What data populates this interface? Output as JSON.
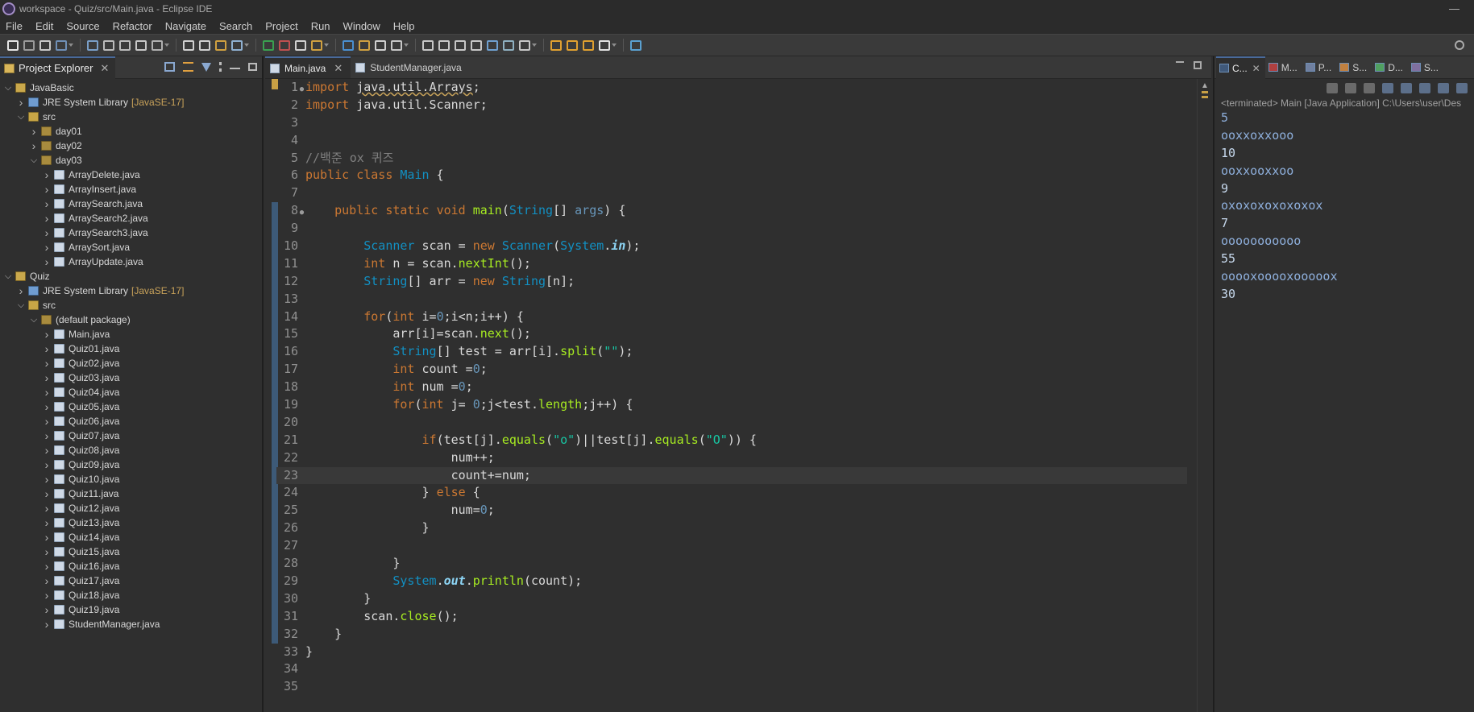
{
  "window": {
    "title": "workspace - Quiz/src/Main.java - Eclipse IDE"
  },
  "menu": [
    "File",
    "Edit",
    "Source",
    "Refactor",
    "Navigate",
    "Search",
    "Project",
    "Run",
    "Window",
    "Help"
  ],
  "explorer": {
    "tab_label": "Project Explorer",
    "tree": [
      {
        "label": "JavaBasic",
        "suffix": "",
        "icon": "project-icon",
        "twisty": "open",
        "depth": 0
      },
      {
        "label": "JRE System Library",
        "suffix": "[JavaSE-17]",
        "icon": "library-icon",
        "twisty": "closed",
        "depth": 1
      },
      {
        "label": "src",
        "suffix": "",
        "icon": "srcfolder-icon",
        "twisty": "open",
        "depth": 1
      },
      {
        "label": "day01",
        "suffix": "",
        "icon": "package-icon",
        "twisty": "closed",
        "depth": 2
      },
      {
        "label": "day02",
        "suffix": "",
        "icon": "package-icon",
        "twisty": "closed",
        "depth": 2
      },
      {
        "label": "day03",
        "suffix": "",
        "icon": "package-icon",
        "twisty": "open",
        "depth": 2
      },
      {
        "label": "ArrayDelete.java",
        "suffix": "",
        "icon": "javafile-icon",
        "twisty": "closed",
        "depth": 3
      },
      {
        "label": "ArrayInsert.java",
        "suffix": "",
        "icon": "javafile-icon",
        "twisty": "closed",
        "depth": 3
      },
      {
        "label": "ArraySearch.java",
        "suffix": "",
        "icon": "javafile-icon",
        "twisty": "closed",
        "depth": 3
      },
      {
        "label": "ArraySearch2.java",
        "suffix": "",
        "icon": "javafile-icon",
        "twisty": "closed",
        "depth": 3
      },
      {
        "label": "ArraySearch3.java",
        "suffix": "",
        "icon": "javafile-icon",
        "twisty": "closed",
        "depth": 3
      },
      {
        "label": "ArraySort.java",
        "suffix": "",
        "icon": "javafile-icon",
        "twisty": "closed",
        "depth": 3
      },
      {
        "label": "ArrayUpdate.java",
        "suffix": "",
        "icon": "javafile-icon",
        "twisty": "closed",
        "depth": 3
      },
      {
        "label": "Quiz",
        "suffix": "",
        "icon": "project-icon",
        "twisty": "open",
        "depth": 0
      },
      {
        "label": "JRE System Library",
        "suffix": "[JavaSE-17]",
        "icon": "library-icon",
        "twisty": "closed",
        "depth": 1
      },
      {
        "label": "src",
        "suffix": "",
        "icon": "srcfolder-icon",
        "twisty": "open",
        "depth": 1
      },
      {
        "label": "(default package)",
        "suffix": "",
        "icon": "package-icon",
        "twisty": "open",
        "depth": 2
      },
      {
        "label": "Main.java",
        "suffix": "",
        "icon": "javafile-icon",
        "twisty": "closed",
        "depth": 3
      },
      {
        "label": "Quiz01.java",
        "suffix": "",
        "icon": "javafile-icon",
        "twisty": "closed",
        "depth": 3
      },
      {
        "label": "Quiz02.java",
        "suffix": "",
        "icon": "javafile-icon",
        "twisty": "closed",
        "depth": 3
      },
      {
        "label": "Quiz03.java",
        "suffix": "",
        "icon": "javafile-icon",
        "twisty": "closed",
        "depth": 3
      },
      {
        "label": "Quiz04.java",
        "suffix": "",
        "icon": "javafile-icon",
        "twisty": "closed",
        "depth": 3
      },
      {
        "label": "Quiz05.java",
        "suffix": "",
        "icon": "javafile-icon",
        "twisty": "closed",
        "depth": 3
      },
      {
        "label": "Quiz06.java",
        "suffix": "",
        "icon": "javafile-icon",
        "twisty": "closed",
        "depth": 3
      },
      {
        "label": "Quiz07.java",
        "suffix": "",
        "icon": "javafile-icon",
        "twisty": "closed",
        "depth": 3
      },
      {
        "label": "Quiz08.java",
        "suffix": "",
        "icon": "javafile-icon",
        "twisty": "closed",
        "depth": 3
      },
      {
        "label": "Quiz09.java",
        "suffix": "",
        "icon": "javafile-icon",
        "twisty": "closed",
        "depth": 3
      },
      {
        "label": "Quiz10.java",
        "suffix": "",
        "icon": "javafile-icon",
        "twisty": "closed",
        "depth": 3
      },
      {
        "label": "Quiz11.java",
        "suffix": "",
        "icon": "javafile-icon",
        "twisty": "closed",
        "depth": 3
      },
      {
        "label": "Quiz12.java",
        "suffix": "",
        "icon": "javafile-icon",
        "twisty": "closed",
        "depth": 3
      },
      {
        "label": "Quiz13.java",
        "suffix": "",
        "icon": "javafile-icon",
        "twisty": "closed",
        "depth": 3
      },
      {
        "label": "Quiz14.java",
        "suffix": "",
        "icon": "javafile-icon",
        "twisty": "closed",
        "depth": 3
      },
      {
        "label": "Quiz15.java",
        "suffix": "",
        "icon": "javafile-icon",
        "twisty": "closed",
        "depth": 3
      },
      {
        "label": "Quiz16.java",
        "suffix": "",
        "icon": "javafile-icon",
        "twisty": "closed",
        "depth": 3
      },
      {
        "label": "Quiz17.java",
        "suffix": "",
        "icon": "javafile-icon",
        "twisty": "closed",
        "depth": 3
      },
      {
        "label": "Quiz18.java",
        "suffix": "",
        "icon": "javafile-icon",
        "twisty": "closed",
        "depth": 3
      },
      {
        "label": "Quiz19.java",
        "suffix": "",
        "icon": "javafile-icon",
        "twisty": "closed",
        "depth": 3
      },
      {
        "label": "StudentManager.java",
        "suffix": "",
        "icon": "javafile-icon",
        "twisty": "closed",
        "depth": 3
      }
    ]
  },
  "editor": {
    "tabs": [
      {
        "label": "Main.java",
        "active": true
      },
      {
        "label": "StudentManager.java",
        "active": false
      }
    ],
    "current_line": 23,
    "lines": [
      [
        [
          "kw",
          "import"
        ],
        [
          "t",
          " "
        ],
        [
          "imp",
          "java.util.Arrays"
        ],
        [
          "t",
          ";"
        ]
      ],
      [
        [
          "kw",
          "import"
        ],
        [
          "t",
          " java.util.Scanner;"
        ]
      ],
      [],
      [],
      [
        [
          "cm",
          "//백준 ox 퀴즈"
        ]
      ],
      [
        [
          "kw",
          "public"
        ],
        [
          "t",
          " "
        ],
        [
          "kw",
          "class"
        ],
        [
          "t",
          " "
        ],
        [
          "ty",
          "Main"
        ],
        [
          "t",
          " {"
        ]
      ],
      [],
      [
        [
          "t",
          "    "
        ],
        [
          "kw",
          "public"
        ],
        [
          "t",
          " "
        ],
        [
          "kw",
          "static"
        ],
        [
          "t",
          " "
        ],
        [
          "kw",
          "void"
        ],
        [
          "t",
          " "
        ],
        [
          "fn",
          "main"
        ],
        [
          "t",
          "("
        ],
        [
          "ty",
          "String"
        ],
        [
          "t",
          "[] "
        ],
        [
          "num",
          "args"
        ],
        [
          "t",
          ") {"
        ]
      ],
      [],
      [
        [
          "t",
          "        "
        ],
        [
          "ty",
          "Scanner"
        ],
        [
          "t",
          " scan = "
        ],
        [
          "kw",
          "new"
        ],
        [
          "t",
          " "
        ],
        [
          "ty",
          "Scanner"
        ],
        [
          "t",
          "("
        ],
        [
          "ty",
          "System"
        ],
        [
          "t",
          "."
        ],
        [
          "st",
          "in"
        ],
        [
          "t",
          ");"
        ]
      ],
      [
        [
          "t",
          "        "
        ],
        [
          "kw",
          "int"
        ],
        [
          "t",
          " n = scan."
        ],
        [
          "fn",
          "nextInt"
        ],
        [
          "t",
          "();"
        ]
      ],
      [
        [
          "t",
          "        "
        ],
        [
          "ty",
          "String"
        ],
        [
          "t",
          "[] arr = "
        ],
        [
          "kw",
          "new"
        ],
        [
          "t",
          " "
        ],
        [
          "ty",
          "String"
        ],
        [
          "t",
          "[n];"
        ]
      ],
      [],
      [
        [
          "t",
          "        "
        ],
        [
          "kw",
          "for"
        ],
        [
          "t",
          "("
        ],
        [
          "kw",
          "int"
        ],
        [
          "t",
          " i="
        ],
        [
          "num",
          "0"
        ],
        [
          "t",
          ";i<n;i++) {"
        ]
      ],
      [
        [
          "t",
          "            arr[i]=scan."
        ],
        [
          "fn",
          "next"
        ],
        [
          "t",
          "();"
        ]
      ],
      [
        [
          "t",
          "            "
        ],
        [
          "ty",
          "String"
        ],
        [
          "t",
          "[] test = arr[i]."
        ],
        [
          "fn",
          "split"
        ],
        [
          "t",
          "("
        ],
        [
          "str",
          "\"\""
        ],
        [
          "t",
          ");"
        ]
      ],
      [
        [
          "t",
          "            "
        ],
        [
          "kw",
          "int"
        ],
        [
          "t",
          " count ="
        ],
        [
          "num",
          "0"
        ],
        [
          "t",
          ";"
        ]
      ],
      [
        [
          "t",
          "            "
        ],
        [
          "kw",
          "int"
        ],
        [
          "t",
          " num ="
        ],
        [
          "num",
          "0"
        ],
        [
          "t",
          ";"
        ]
      ],
      [
        [
          "t",
          "            "
        ],
        [
          "kw",
          "for"
        ],
        [
          "t",
          "("
        ],
        [
          "kw",
          "int"
        ],
        [
          "t",
          " j= "
        ],
        [
          "num",
          "0"
        ],
        [
          "t",
          ";j<test."
        ],
        [
          "fn",
          "length"
        ],
        [
          "t",
          ";j++) {"
        ]
      ],
      [],
      [
        [
          "t",
          "                "
        ],
        [
          "kw",
          "if"
        ],
        [
          "t",
          "(test[j]."
        ],
        [
          "fn",
          "equals"
        ],
        [
          "t",
          "("
        ],
        [
          "str",
          "\"o\""
        ],
        [
          "t",
          ")||test[j]."
        ],
        [
          "fn",
          "equals"
        ],
        [
          "t",
          "("
        ],
        [
          "str",
          "\"O\""
        ],
        [
          "t",
          ")) {"
        ]
      ],
      [
        [
          "t",
          "                    num++;"
        ]
      ],
      [
        [
          "t",
          "                    count+=num;"
        ]
      ],
      [
        [
          "t",
          "                } "
        ],
        [
          "kw",
          "else"
        ],
        [
          "t",
          " {"
        ]
      ],
      [
        [
          "t",
          "                    num="
        ],
        [
          "num",
          "0"
        ],
        [
          "t",
          ";"
        ]
      ],
      [
        [
          "t",
          "                }"
        ]
      ],
      [],
      [
        [
          "t",
          "            }"
        ]
      ],
      [
        [
          "t",
          "            "
        ],
        [
          "ty",
          "System"
        ],
        [
          "t",
          "."
        ],
        [
          "st",
          "out"
        ],
        [
          "t",
          "."
        ],
        [
          "fn",
          "println"
        ],
        [
          "t",
          "(count);"
        ]
      ],
      [
        [
          "t",
          "        }"
        ]
      ],
      [
        [
          "t",
          "        scan."
        ],
        [
          "fn",
          "close"
        ],
        [
          "t",
          "();"
        ]
      ],
      [
        [
          "t",
          "    }"
        ]
      ],
      [
        [
          "t",
          "}"
        ]
      ],
      [],
      []
    ],
    "fold_lines": [
      1,
      8
    ]
  },
  "console": {
    "tabs": [
      {
        "label": "C...",
        "active": true
      },
      {
        "label": "M...",
        "active": false
      },
      {
        "label": "P...",
        "active": false
      },
      {
        "label": "S...",
        "active": false
      },
      {
        "label": "D...",
        "active": false
      },
      {
        "label": "S...",
        "active": false
      }
    ],
    "status": "<terminated> Main [Java Application] C:\\Users\\user\\Des",
    "output": [
      {
        "text": "5",
        "input": true
      },
      {
        "text": "ooxxoxxooo",
        "input": true
      },
      {
        "text": "10",
        "input": false
      },
      {
        "text": "ooxxooxxoo",
        "input": true
      },
      {
        "text": "9",
        "input": false
      },
      {
        "text": "oxoxoxoxoxoxox",
        "input": true
      },
      {
        "text": "7",
        "input": false
      },
      {
        "text": "ooooooooooo",
        "input": true
      },
      {
        "text": "55",
        "input": false
      },
      {
        "text": "ooooxooooxooooox",
        "input": true
      },
      {
        "text": "30",
        "input": false
      }
    ]
  }
}
